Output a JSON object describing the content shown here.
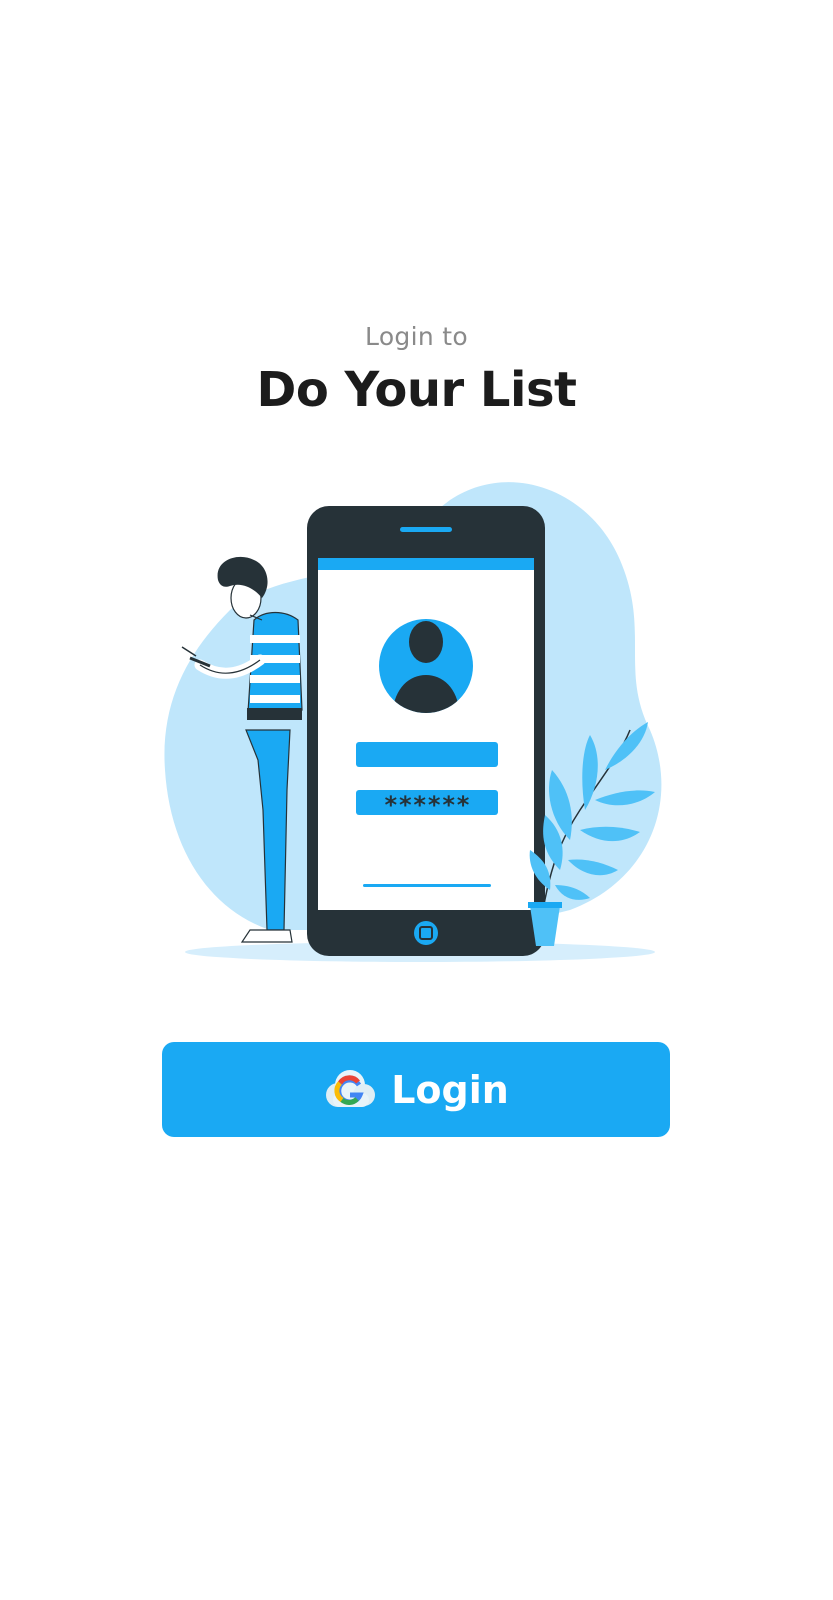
{
  "header": {
    "subtitle": "Login to",
    "title": "Do Your List"
  },
  "illustration": {
    "password_mask": "******"
  },
  "login_button": {
    "label": "Login",
    "icon": "google-icon"
  },
  "colors": {
    "accent": "#1aa9f3",
    "phone_body": "#263238",
    "blob": "#bfe6fb",
    "title": "#1c1c1c",
    "subtitle": "#8a8a8a"
  }
}
